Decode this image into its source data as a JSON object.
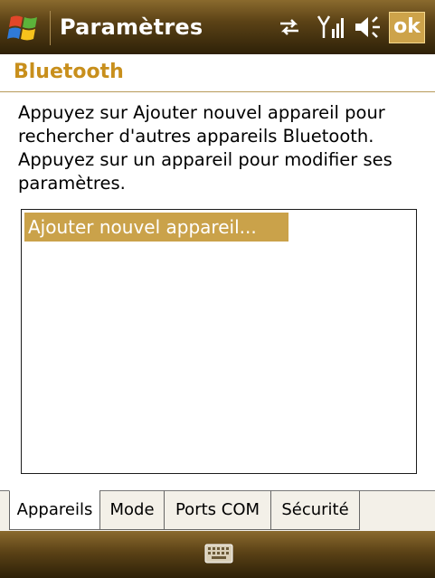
{
  "titlebar": {
    "title": "Paramètres",
    "ok_label": "ok",
    "icons": [
      "windows-start-icon",
      "sync-icon",
      "signal-icon",
      "speaker-icon"
    ]
  },
  "section": {
    "title": "Bluetooth"
  },
  "instructions": "Appuyez sur Ajouter nouvel appareil pour rechercher d'autres appareils Bluetooth. Appuyez sur un appareil pour modifier ses paramètres.",
  "device_list": {
    "items": [
      "Ajouter nouvel appareil..."
    ]
  },
  "tabs": [
    {
      "label": "Appareils",
      "active": true
    },
    {
      "label": "Mode",
      "active": false
    },
    {
      "label": "Ports COM",
      "active": false
    },
    {
      "label": "Sécurité",
      "active": false
    }
  ],
  "bottombar": {
    "icon": "keyboard-icon"
  },
  "colors": {
    "bar_top": "#8a6a2e",
    "bar_bottom": "#2e2108",
    "accent": "#caa24a",
    "section_title": "#c88f1c"
  }
}
